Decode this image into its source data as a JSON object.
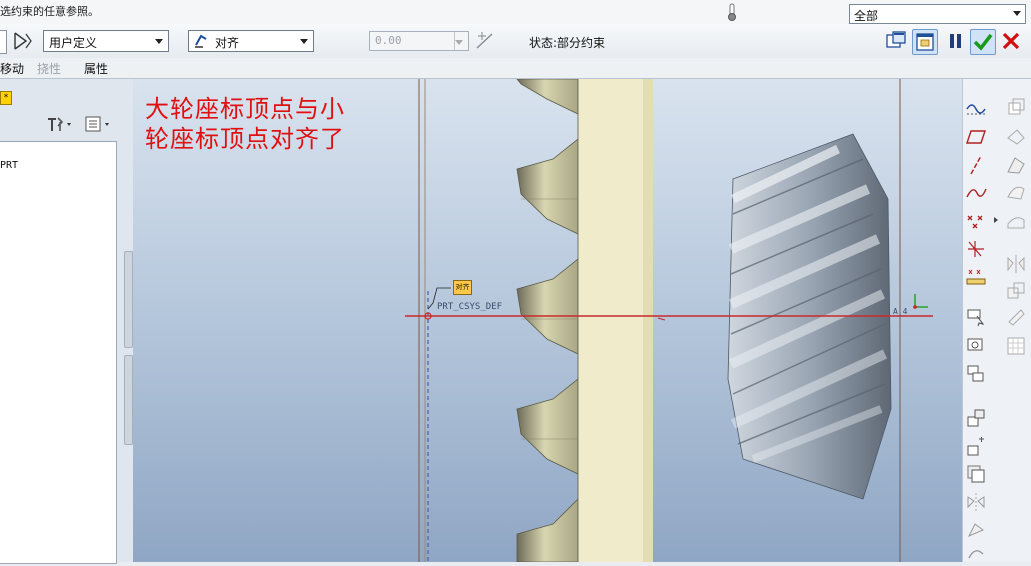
{
  "message": {
    "text": "选约束的任意参照。"
  },
  "filter": {
    "value": "全部"
  },
  "dashboard": {
    "constraint_set": "用户定义",
    "constraint_type": "对齐",
    "offset_value": "0.00",
    "status": "状态:部分约束"
  },
  "tabs": [
    {
      "label": "移动"
    },
    {
      "label": "挠性"
    },
    {
      "label": "属性"
    }
  ],
  "model_tree": {
    "item": "PRT"
  },
  "graphics": {
    "annotation_line1": "大轮座标顶点与小",
    "annotation_line2": "轮座标顶点对齐了",
    "csys_label": "PRT_CSYS_DEF",
    "align_tag": "对齐",
    "axis_label": "A_4"
  },
  "icons": {
    "accept": "check-icon",
    "cancel": "x-icon",
    "pause": "pause-icon",
    "color_accept": "#1a9a1a",
    "color_cancel": "#d01010"
  }
}
